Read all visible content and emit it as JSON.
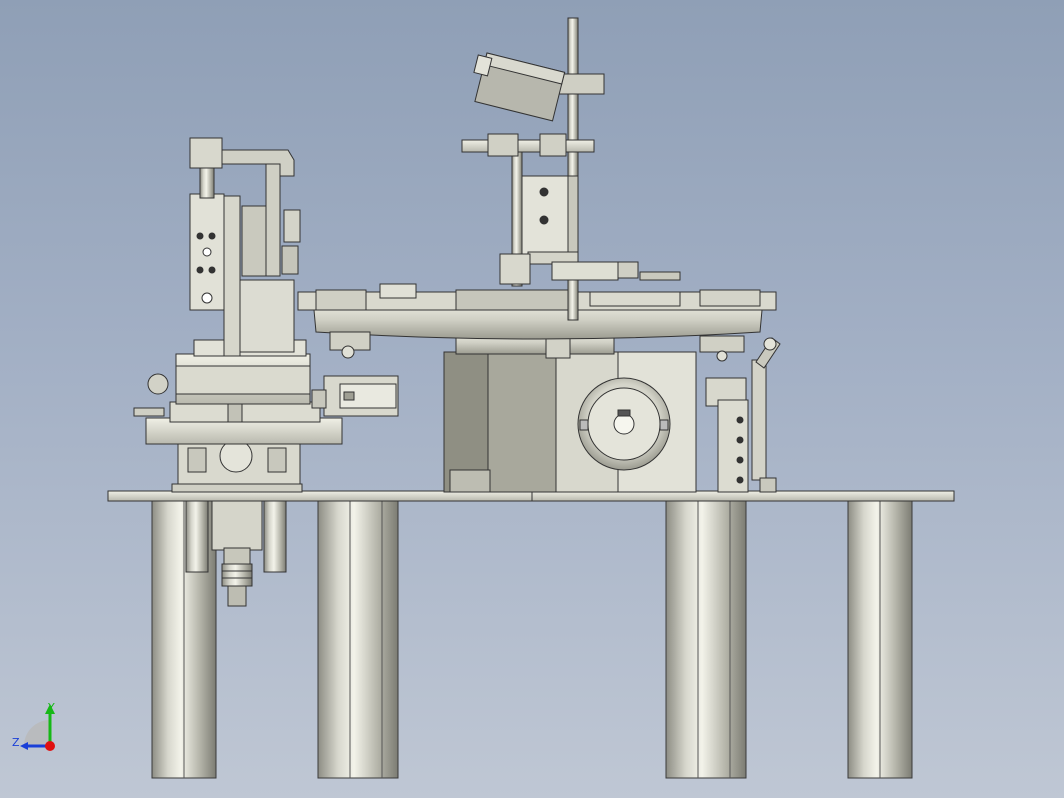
{
  "triad": {
    "x_label": "",
    "y_label": "Y",
    "z_label": "Z",
    "colors": {
      "x": "#e01010",
      "y": "#16b816",
      "z": "#1a3fd8"
    }
  },
  "palette": {
    "background_top": "#8f9fb6",
    "background_bottom": "#bfc7d4",
    "metal_light": "#e6e6dc",
    "metal_mid": "#c9c9bd",
    "metal_dark": "#8d8d82",
    "outline": "#2c2c2c",
    "housing_dark": "#8f8f83"
  }
}
